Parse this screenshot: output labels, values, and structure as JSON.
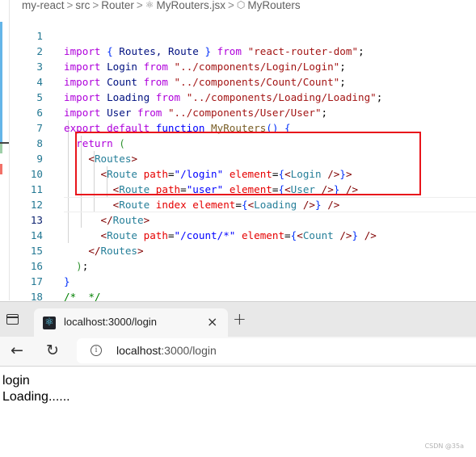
{
  "editor": {
    "breadcrumb": [
      {
        "label": "my-react",
        "icon": null
      },
      {
        "label": "src",
        "icon": null
      },
      {
        "label": "Router",
        "icon": null
      },
      {
        "label": "MyRouters.jsx",
        "icon": "react-file-icon"
      },
      {
        "label": "MyRouters",
        "icon": "symbol-method-icon"
      }
    ],
    "separator": ">",
    "icons": {
      "react_glyph": "⚛",
      "cube_glyph": "⬡"
    },
    "lines": [
      {
        "n": "1"
      },
      {
        "n": "2"
      },
      {
        "n": "3"
      },
      {
        "n": "4"
      },
      {
        "n": "5"
      },
      {
        "n": "6"
      },
      {
        "n": "7"
      },
      {
        "n": "8"
      },
      {
        "n": "9"
      },
      {
        "n": "10"
      },
      {
        "n": "11"
      },
      {
        "n": "12"
      },
      {
        "n": "13"
      },
      {
        "n": "14"
      },
      {
        "n": "15"
      },
      {
        "n": "16"
      },
      {
        "n": "17"
      },
      {
        "n": "18"
      }
    ],
    "tokens": {
      "import": "import",
      "from": "from",
      "export": "export",
      "default": "default",
      "function": "function",
      "return": "return",
      "l1_names": "Routes, Route",
      "l1_src": "\"react-router-dom\"",
      "l2_name": "Login",
      "l2_src": "\"../components/Login/Login\"",
      "l3_name": "Count",
      "l3_src": "\"../components/Count/Count\"",
      "l4_name": "Loading",
      "l4_src": "\"../components/Loading/Loading\"",
      "l5_name": "User",
      "l5_src": "\"../components/User/User\"",
      "fn_name": "MyRouters",
      "routes_tag": "Routes",
      "route_tag": "Route",
      "attr_path": "path",
      "attr_element": "element",
      "attr_index": "index",
      "v_login": "\"/login\"",
      "v_user": "\"user\"",
      "v_count": "\"/count/*\"",
      "c_login": "Login",
      "c_user": "User",
      "c_loading": "Loading",
      "c_count": "Count",
      "comment": "/*  */"
    }
  },
  "browser": {
    "tab": {
      "title": "localhost:3000/login",
      "favicon": "⚛",
      "close": "×"
    },
    "new_tab": "+",
    "back": "←",
    "reload": "↻",
    "info": "i",
    "url_host": "localhost",
    "url_rest": ":3000/login",
    "page_lines": [
      "login",
      "Loading......"
    ]
  },
  "watermark": "CSDN @35a",
  "colors": {
    "highlight_box": "#e8141b"
  }
}
